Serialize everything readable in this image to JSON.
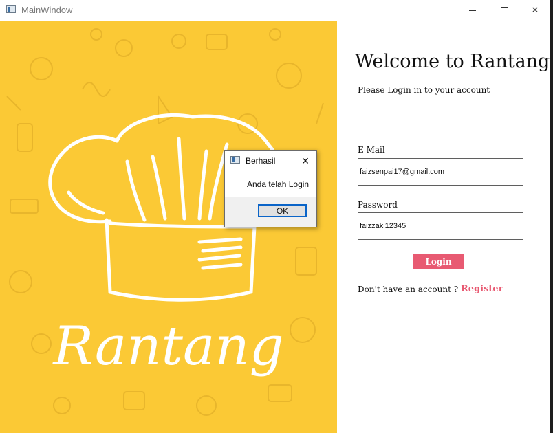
{
  "window": {
    "title": "MainWindow",
    "close_glyph": "✕"
  },
  "hero": {
    "brand_text": "Rantang",
    "background_color": "#fbc935",
    "icon": "chef-hat-icon"
  },
  "login": {
    "welcome_title": "Welcome to Rantang",
    "subtitle": "Please Login in to your account",
    "email_label": "E Mail",
    "email_value": "faizsenpai17@gmail.com",
    "password_label": "Password",
    "password_value": "faizzaki12345",
    "login_button": "Login",
    "no_account_text": "Don't  have an account ?",
    "register_link": "Register",
    "accent_color": "#e85a72"
  },
  "dialog": {
    "title": "Berhasil",
    "message": "Anda telah Login",
    "ok_button": "OK",
    "close_glyph": "✕"
  }
}
